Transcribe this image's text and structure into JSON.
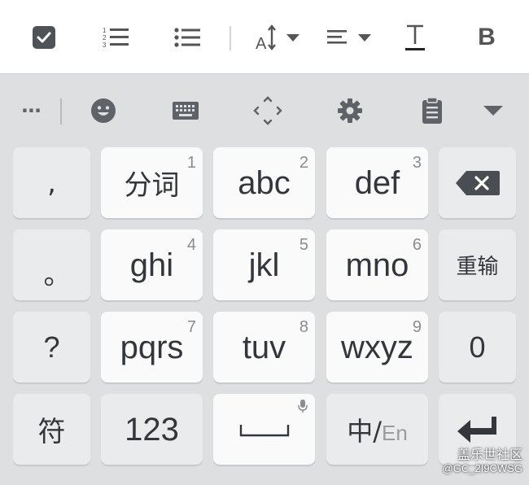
{
  "toolbar": {
    "icons": [
      "checkbox-icon",
      "numbered-list-icon",
      "bulleted-list-icon",
      "text-size-icon",
      "text-align-icon",
      "text-color-icon",
      "bold-icon"
    ],
    "bold_label": "B"
  },
  "suggestion_bar": {
    "more_label": "···",
    "icons": [
      "emoji-icon",
      "keyboard-icon",
      "move-cursor-icon",
      "settings-icon",
      "clipboard-icon",
      "collapse-icon"
    ]
  },
  "keys": {
    "comma": ",",
    "period": "。",
    "question": "?",
    "symbols": "符",
    "k1_label": "分词",
    "k1_num": "1",
    "k2_label": "abc",
    "k2_num": "2",
    "k3_label": "def",
    "k3_num": "3",
    "k4_label": "ghi",
    "k4_num": "4",
    "k5_label": "jkl",
    "k5_num": "5",
    "k6_label": "mno",
    "k6_num": "6",
    "k7_label": "pqrs",
    "k7_num": "7",
    "k8_label": "tuv",
    "k8_num": "8",
    "k9_label": "wxyz",
    "k9_num": "9",
    "numbers": "123",
    "zero": "0",
    "retype": "重输",
    "lang_zh": "中/",
    "lang_en": "En"
  },
  "colors": {
    "toolbar_bg": "#ffffff",
    "keyboard_bg": "#dedfe1",
    "light_key": "#fafafa",
    "function_key": "#eaebed",
    "icon": "#5f6266"
  },
  "watermark": {
    "line1": "盖乐世社区",
    "line2": "@GC_2I9CWSG"
  }
}
